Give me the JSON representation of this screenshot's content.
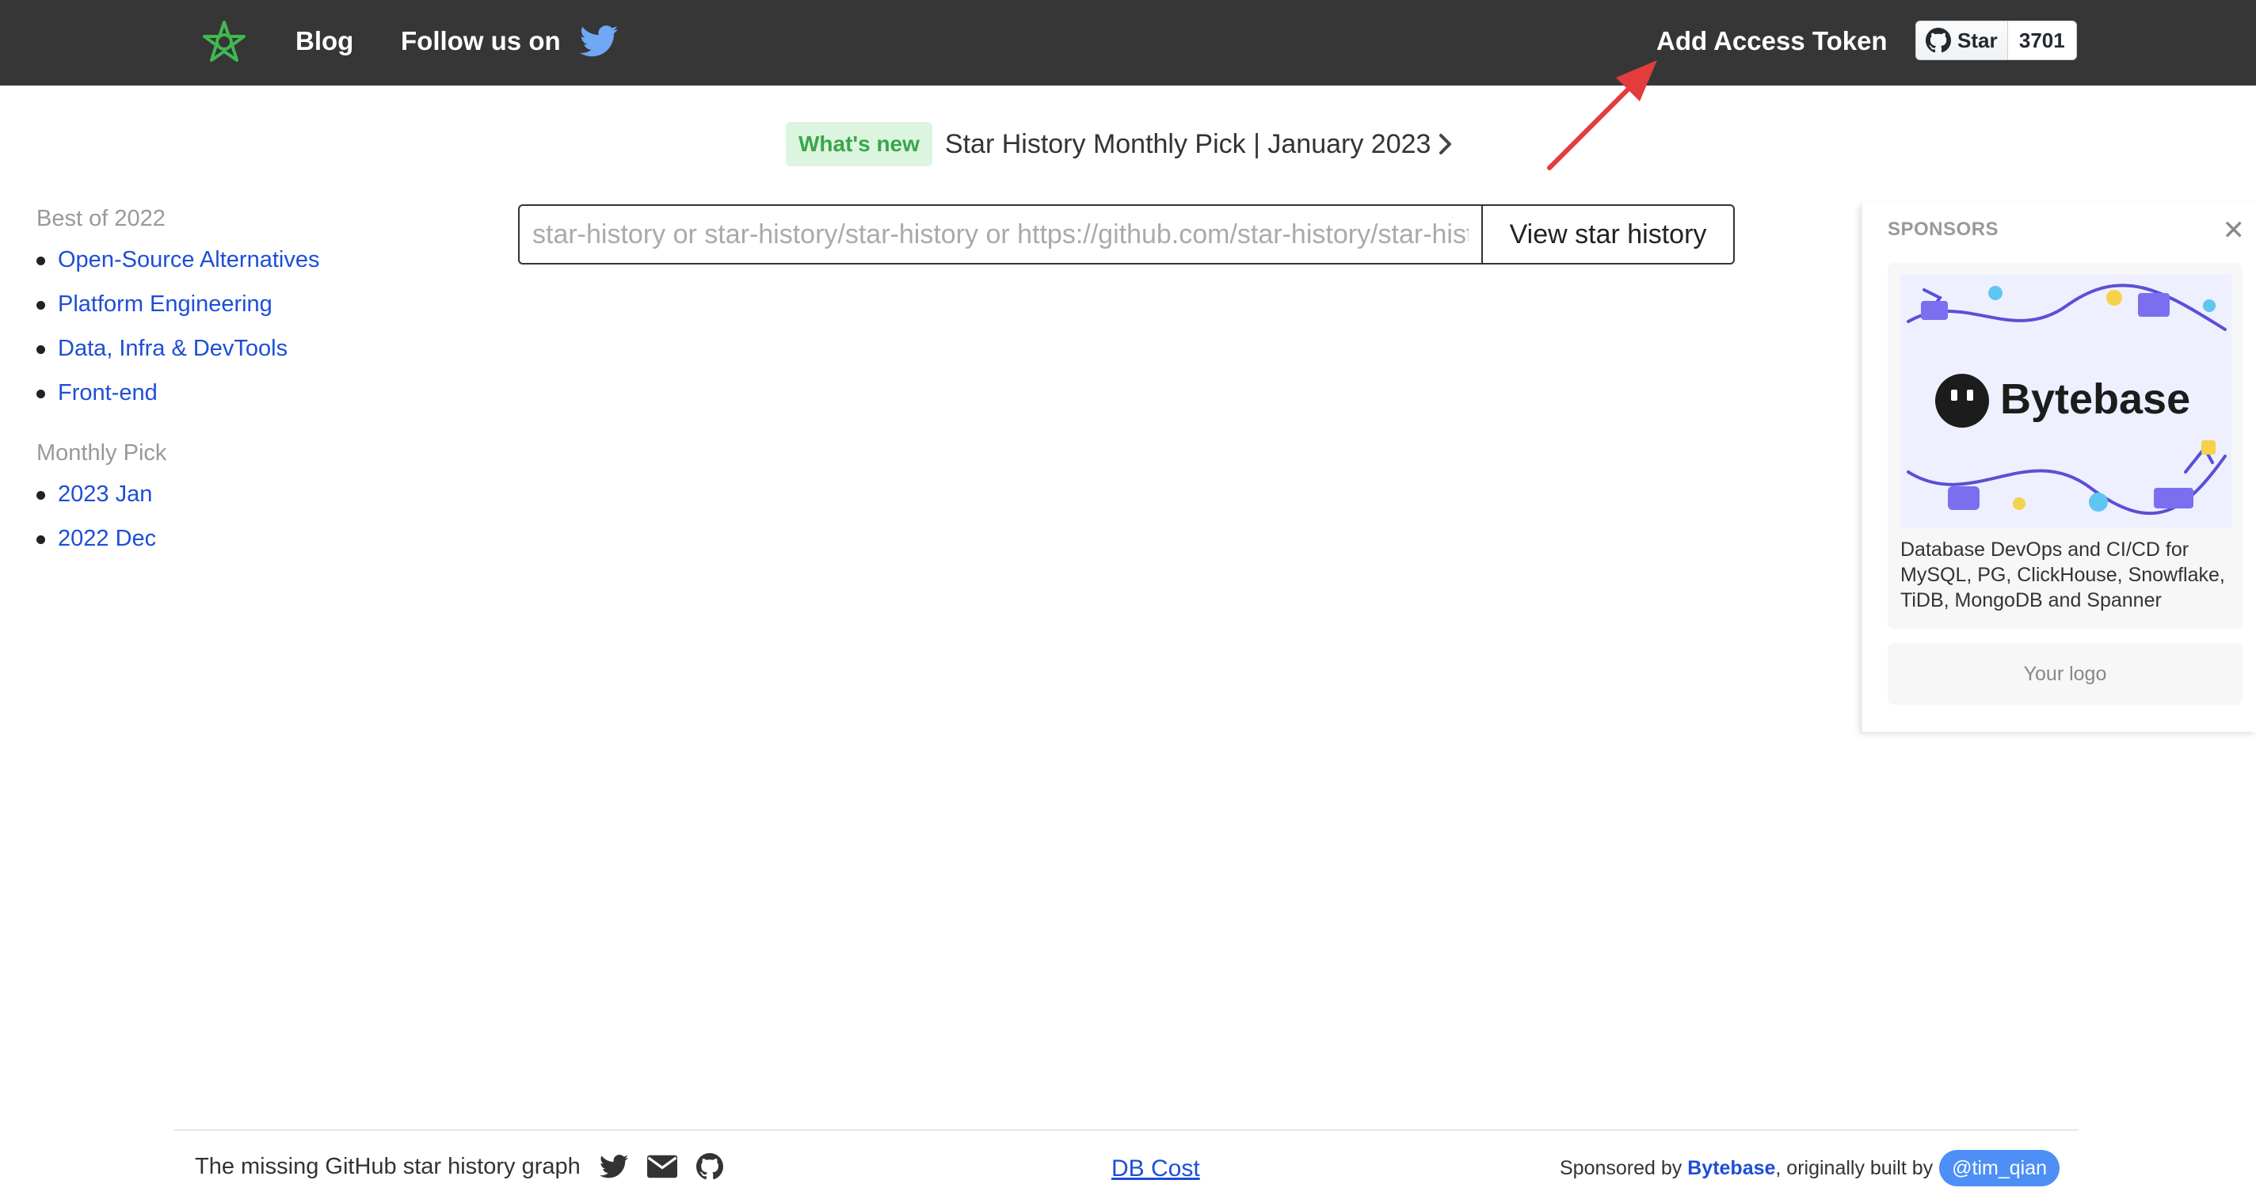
{
  "header": {
    "blog_label": "Blog",
    "follow_label": "Follow us on",
    "access_token_label": "Add Access Token",
    "github_star": {
      "label": "Star",
      "count": "3701"
    }
  },
  "whats_new": {
    "badge": "What's new",
    "text": "Star History Monthly Pick | January 2023"
  },
  "sidebar": {
    "sections": [
      {
        "heading": "Best of 2022",
        "items": [
          "Open-Source Alternatives",
          "Platform Engineering",
          "Data, Infra & DevTools",
          "Front-end"
        ]
      },
      {
        "heading": "Monthly Pick",
        "items": [
          "2023 Jan",
          "2022 Dec"
        ]
      }
    ]
  },
  "search": {
    "placeholder": "star-history or star-history/star-history or https://github.com/star-history/star-history",
    "value": "",
    "button_label": "View star history"
  },
  "sponsors": {
    "title": "SPONSORS",
    "close_glyph": "✕",
    "card": {
      "banner_text": "Bytebase",
      "description": "Database DevOps and CI/CD for MySQL, PG, ClickHouse, Snowflake, TiDB, MongoDB and Spanner"
    },
    "logo_slot": "Your logo"
  },
  "footer": {
    "tagline": "The missing GitHub star history graph",
    "db_cost": "DB Cost",
    "sponsored_by": "Sponsored by",
    "bytebase": "Bytebase",
    "originally": ", originally built by",
    "author": "@tim_qian"
  },
  "colors": {
    "header_bg": "#363636",
    "link": "#1d4ed8",
    "badge_green_bg": "#dcf5df",
    "badge_green_text": "#3aa54a",
    "logo_green": "#3fb950",
    "twitter_blue": "#6fa8f5",
    "arrow_red": "#e23c3c",
    "author_badge": "#4d8ff4"
  },
  "icons": [
    "star-logo-icon",
    "twitter-icon",
    "github-icon",
    "chevron-right-icon",
    "close-icon",
    "mail-icon"
  ]
}
